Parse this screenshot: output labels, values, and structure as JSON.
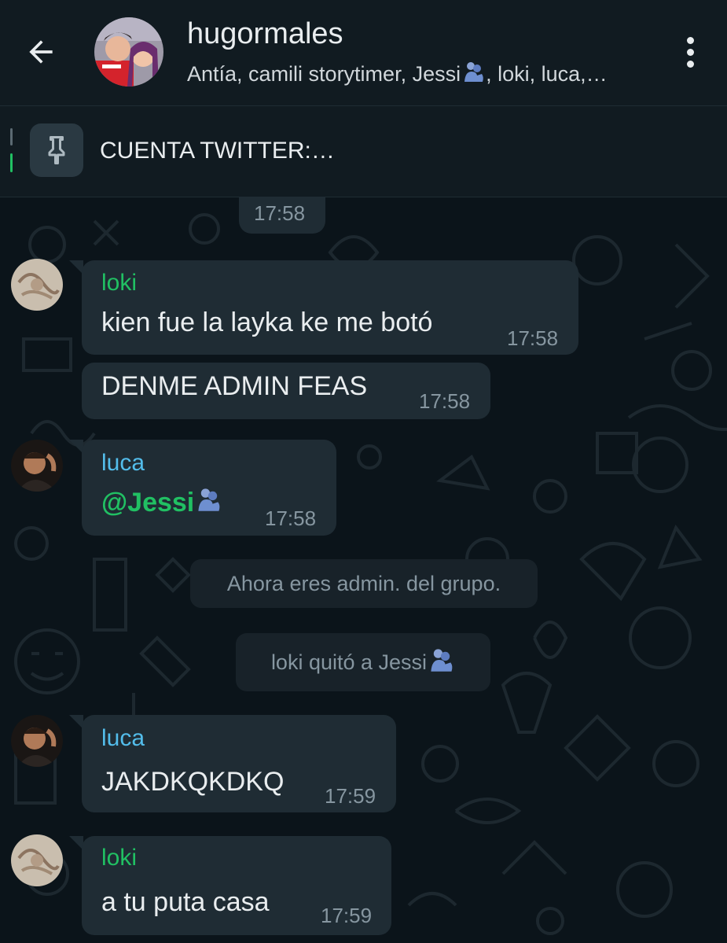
{
  "header": {
    "title": "hugormales",
    "members": "Antía, camili storytimer, Jessi",
    "members_tail": ", loki, luca,…"
  },
  "pinned": {
    "text": "CUENTA TWITTER:…"
  },
  "colors": {
    "background": "#0b141a",
    "bubble": "#1f2c34",
    "accent_green": "#21c063",
    "loki_name": "#21c063",
    "luca_name": "#53bdeb"
  },
  "icons": {
    "back": "arrow-left-icon",
    "menu": "more-vertical-icon",
    "pin": "pin-icon",
    "emoji": "people-hugging-icon"
  },
  "messages": {
    "time_top": "17:58",
    "m1": {
      "sender": "loki",
      "text": "kien fue la layka ke me botó",
      "time": "17:58"
    },
    "m2": {
      "text": "DENME ADMIN FEAS",
      "time": "17:58"
    },
    "m3": {
      "sender": "luca",
      "text": "@Jessi",
      "time": "17:58"
    },
    "sys1": "Ahora eres admin. del grupo.",
    "sys2": "loki quitó a Jessi",
    "m4": {
      "sender": "luca",
      "text": "JAKDKQKDKQ",
      "time": "17:59"
    },
    "m5": {
      "sender": "loki",
      "text": "a tu puta casa",
      "time": "17:59"
    }
  }
}
